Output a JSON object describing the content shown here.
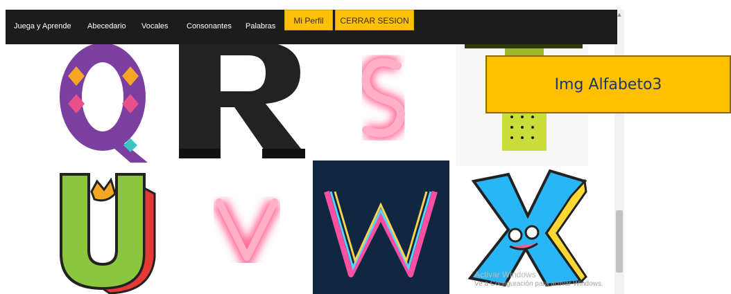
{
  "nav": {
    "items": [
      "Juega y Aprende",
      "Abecedario",
      "Vocales",
      "Consonantes",
      "Palabras"
    ],
    "profile_button": "Mi Perfil",
    "logout_button": "CERRAR SESION"
  },
  "caption": {
    "text": "Img Alfabeto3"
  },
  "letters": [
    {
      "letter": "Q",
      "style": "patterned-purple"
    },
    {
      "letter": "R",
      "style": "black-serif-3d"
    },
    {
      "letter": "S",
      "style": "pink-neon"
    },
    {
      "letter": "T",
      "style": "yellow-green-dotted"
    },
    {
      "letter": "U",
      "style": "green-cartoon"
    },
    {
      "letter": "V",
      "style": "pink-neon"
    },
    {
      "letter": "W",
      "style": "multicolor-neon"
    },
    {
      "letter": "X",
      "style": "blue-cartoon"
    }
  ],
  "watermark": {
    "title": "Activar Windows",
    "subtitle": "Ve a Configuración para activar Windows."
  },
  "colors": {
    "nav_bg": "#1c1c1c",
    "button_bg": "#ffc107",
    "caption_bg": "#ffc000",
    "caption_text": "#1f3864"
  }
}
